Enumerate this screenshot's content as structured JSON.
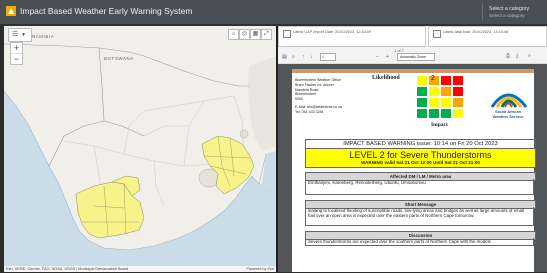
{
  "header": {
    "title": "Impact Based Weather Early Warning System",
    "category_label": "Select a category",
    "category_value": "Select a category"
  },
  "map": {
    "toolbar_icons": [
      "list-icon",
      "chevron-down-icon"
    ],
    "labels": {
      "namibia": "NAMIBIA",
      "botswana": "BOTSWANA"
    },
    "attribution": "Esri, HERE, Garmin, FAO, NOAA, USGS | Municipal Demarcation Board",
    "powered_by": "Powered by Esri"
  },
  "info": {
    "cap_import": "Latest CAP Import Date: 20/10/2023, 12:43:09",
    "last_data": "Latest data load: 20/10/2023, 13:15:48"
  },
  "pdf": {
    "page_indicator": "1 of 7",
    "page_number": "1",
    "zoom": "Automatic Zoom",
    "office": {
      "line1": "Bloemfontein Weather Office",
      "line2": "Bram Fischer Int. Airport",
      "line3": "Mandela Road",
      "line4": "Bloemfontein",
      "line5": "9300",
      "email": "E-Mail: bfn@weathersa.co.za",
      "tel": "Tel: 051 433 3281"
    },
    "likelihood_label": "Likelihood",
    "impact_label": "Impact",
    "matrix_level": "2",
    "saws_name1": "South African",
    "saws_name2": "Weather Service",
    "issue": "IMPACT BASED WARNING issue: 10:14 on Fri 20 Oct 2023",
    "level_title": "LEVEL 2 for Severe Thunderstorms",
    "valid": "WARNING valid Sat 21 Oct 12:00 Until Sat 21 Oct 21:00",
    "affected_header": "Affected DM / LM / Metro area",
    "affected_text": "Emthanjeni, Kareeberg, Renosterberg, Ubuntu, Umsobomvu",
    "short_header": "Short Message",
    "short_text": "leading to localised flooding of susceptible roads, low-lying areas and bridges as well as large amounts of small hail over an open area is expected over the eastern parts of Northern Cape tomorrow.",
    "discussion_header": "Discussion",
    "discussion_text": "Severe thunderstorms are expected over the southern parts of Northern Cape with the models"
  },
  "colors": {
    "warning_yellow": "#ffff00",
    "header_bg": "#4a4f55",
    "saws_blue": "#1e5a94"
  }
}
